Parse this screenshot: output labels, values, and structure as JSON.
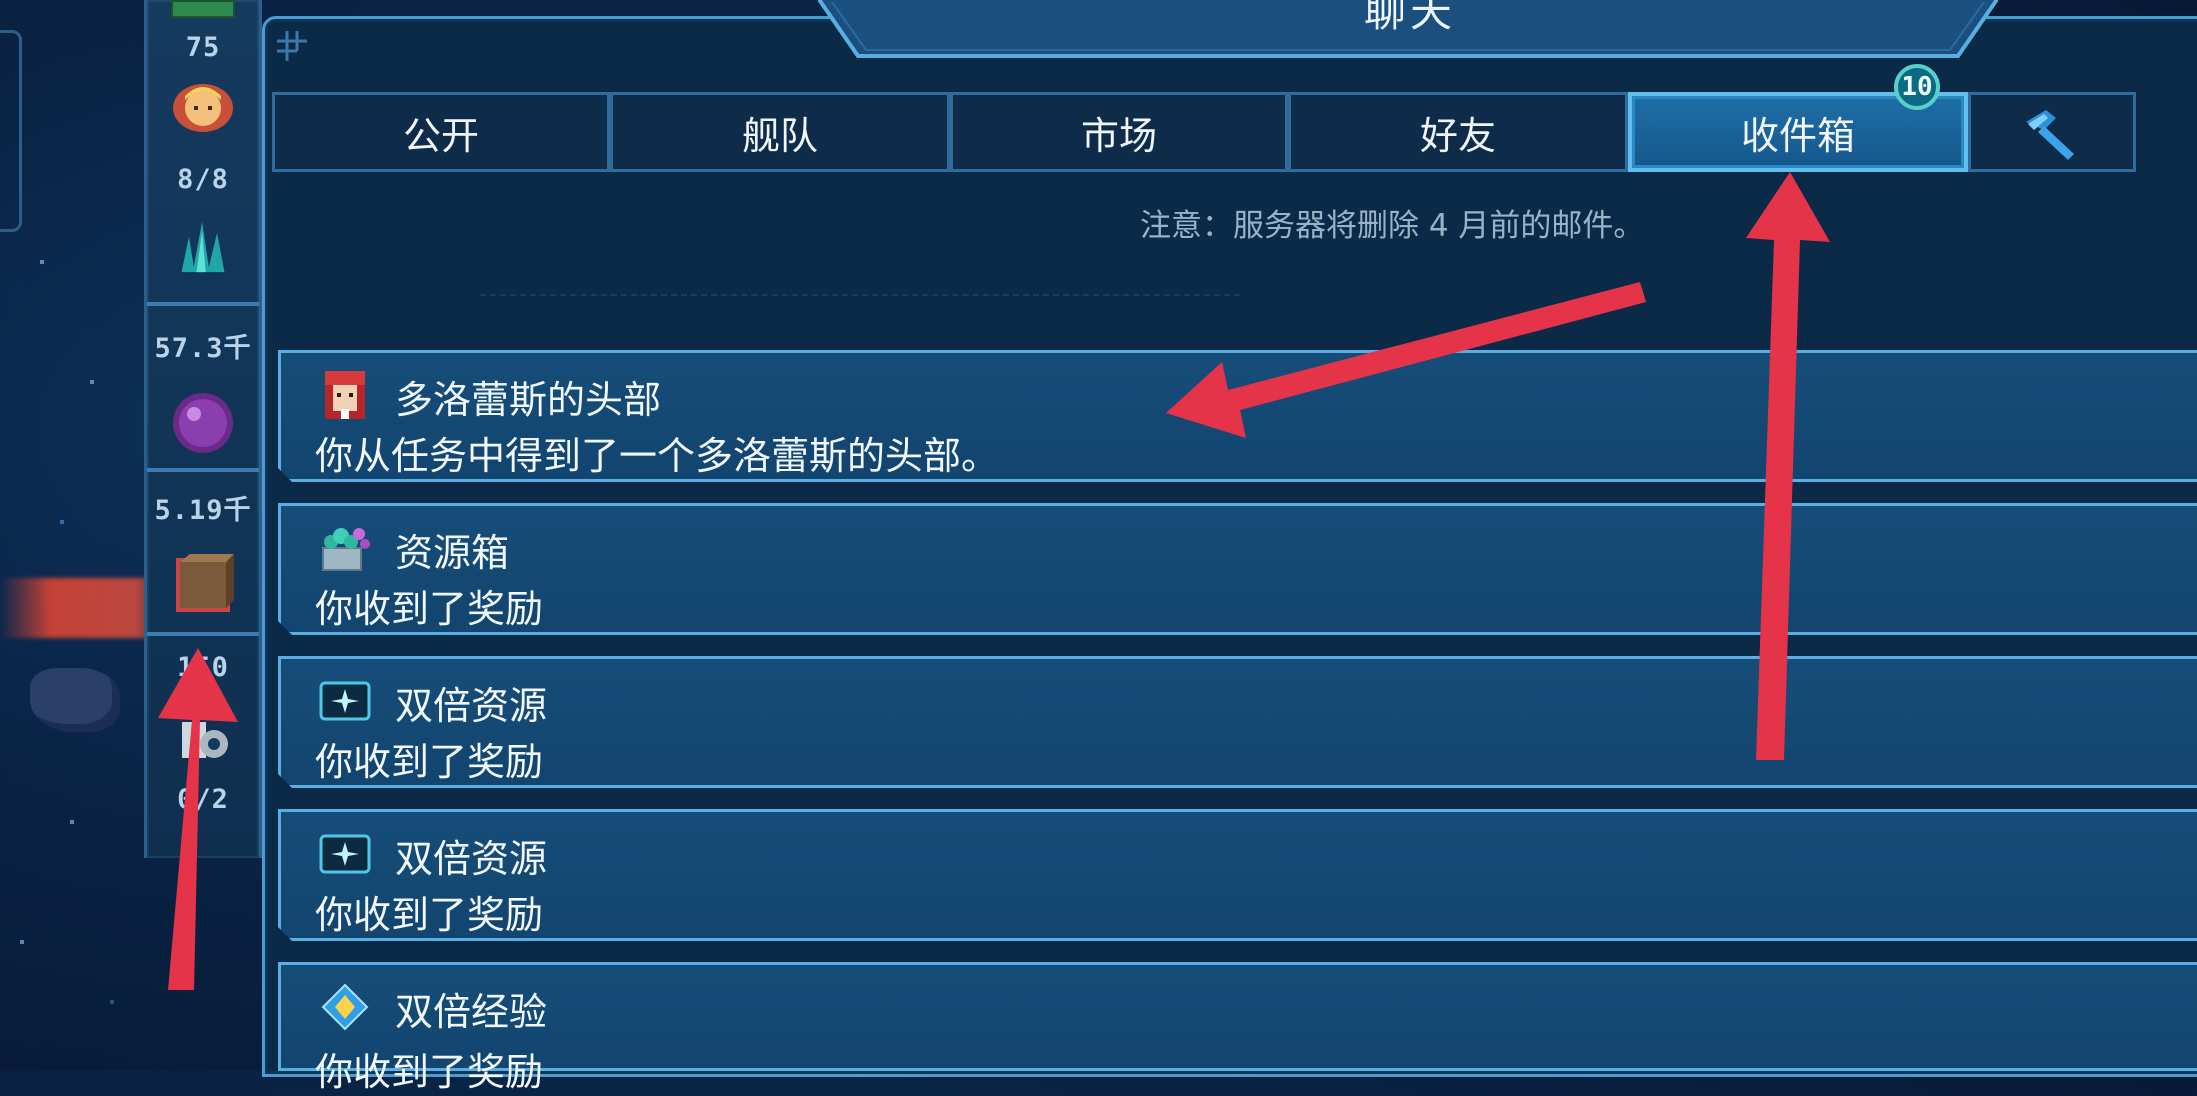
{
  "window": {
    "title": "聊天"
  },
  "tabs": [
    {
      "label": "公开"
    },
    {
      "label": "舰队"
    },
    {
      "label": "市场"
    },
    {
      "label": "好友"
    },
    {
      "label": "收件箱",
      "active": true,
      "badge": "10"
    },
    {
      "icon": "hammer-icon"
    }
  ],
  "notice": "注意：服务器将删除 4 月前的邮件。",
  "resources": [
    {
      "value": "75",
      "icon": "crew-portrait-icon"
    },
    {
      "value": "8/8",
      "icon": "crystal-cluster-icon"
    },
    {
      "value": "57.3千",
      "icon": "purple-orb-icon"
    },
    {
      "value": "5.19千",
      "icon": "crate-icon"
    },
    {
      "value": "150",
      "icon": "gear-cog-icon"
    },
    {
      "value": "0/2",
      "icon": ""
    }
  ],
  "mails": [
    {
      "icon": "red-hair-portrait-icon",
      "title": "多洛蕾斯的头部",
      "body": "你从任务中得到了一个多洛蕾斯的头部。"
    },
    {
      "icon": "resource-box-icon",
      "title": "资源箱",
      "body": "你收到了奖励"
    },
    {
      "icon": "double-resource-icon",
      "title": "双倍资源",
      "body": "你收到了奖励"
    },
    {
      "icon": "double-resource-icon",
      "title": "双倍资源",
      "body": "你收到了奖励"
    },
    {
      "icon": "double-exp-icon",
      "title": "双倍经验",
      "body": "你收到了奖励"
    }
  ],
  "colors": {
    "arrow": "#e5334a",
    "accent": "#5fc0f0",
    "panel": "#0b2a47"
  }
}
